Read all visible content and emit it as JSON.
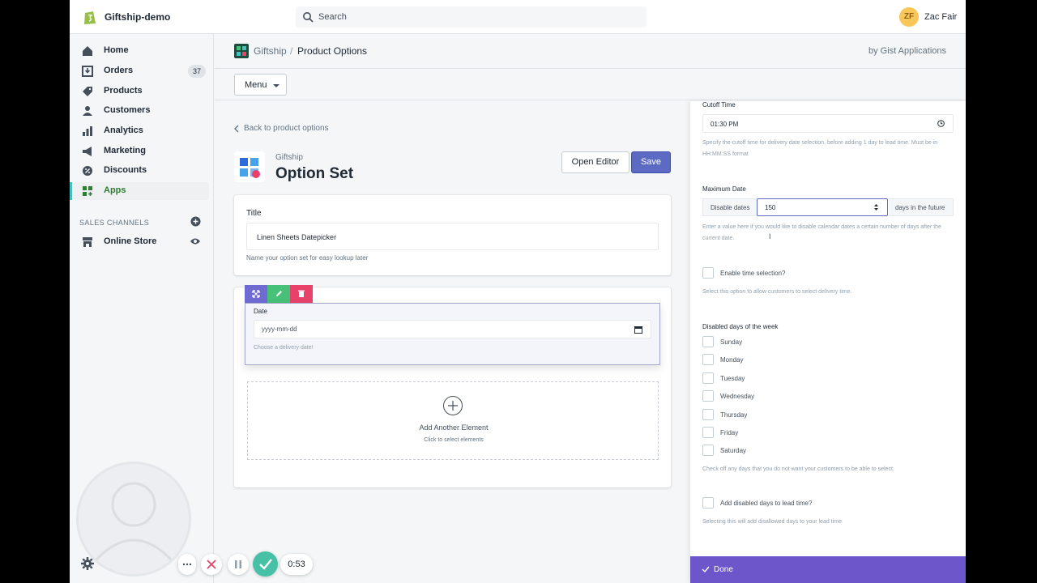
{
  "topbar": {
    "store_name": "Giftship-demo",
    "search_placeholder": "Search",
    "user_initials": "ZF",
    "user_name": "Zac Fair"
  },
  "sidebar": {
    "items": [
      {
        "label": "Home",
        "icon": "home-icon"
      },
      {
        "label": "Orders",
        "icon": "orders-icon",
        "badge": "37"
      },
      {
        "label": "Products",
        "icon": "tag-icon"
      },
      {
        "label": "Customers",
        "icon": "person-icon"
      },
      {
        "label": "Analytics",
        "icon": "bar-chart-icon"
      },
      {
        "label": "Marketing",
        "icon": "megaphone-icon"
      },
      {
        "label": "Discounts",
        "icon": "discount-icon"
      },
      {
        "label": "Apps",
        "icon": "apps-icon",
        "active": true
      }
    ],
    "sales_channels_title": "SALES CHANNELS",
    "online_store_label": "Online Store"
  },
  "app_header": {
    "app_name": "Giftship",
    "separator": "/",
    "page_name": "Product Options",
    "by_line": "by Gist Applications",
    "menu_label": "Menu"
  },
  "main": {
    "back_link": "Back to product options",
    "subtitle": "Giftship",
    "title": "Option Set",
    "open_editor_label": "Open Editor",
    "save_label": "Save",
    "title_card": {
      "label": "Title",
      "value": "Linen Sheets Datepicker",
      "help": "Name your option set for easy lookup later"
    },
    "date_element": {
      "label": "Date",
      "placeholder": "yyyy-mm-dd",
      "help": "Choose a delivery date!"
    },
    "add_element": {
      "title": "Add Another Element",
      "subtitle": "Click to select elements"
    }
  },
  "panel": {
    "cutoff_label": "Cutoff Time",
    "cutoff_value": "01:30 PM",
    "cutoff_help": "Specify the cutoff time for delivery date selection, before adding 1 day to lead time. Must be in HH:MM:SS format",
    "max_date_label": "Maximum Date",
    "disable_dates_prefix": "Disable dates",
    "max_date_value": "150",
    "days_suffix": "days in the future",
    "max_date_help": "Enter a value here if you would like to disable calendar dates a certain number of days after the current date.",
    "enable_time_label": "Enable time selection?",
    "enable_time_help": "Select this option to allow customers to select delivery time.",
    "disabled_days_title": "Disabled days of the week",
    "days": [
      "Sunday",
      "Monday",
      "Tuesday",
      "Wednesday",
      "Thursday",
      "Friday",
      "Saturday"
    ],
    "days_help": "Check off any days that you do not want your customers to be able to select.",
    "add_disabled_label": "Add disabled days to lead time?",
    "add_disabled_help": "Selecting this will add disallowed days to your lead time",
    "done_label": "Done"
  },
  "recorder": {
    "time": "0:53"
  },
  "colors": {
    "primary": "#5c6ac4",
    "done_bar": "#6c56c9",
    "active_nav": "#2e7d32"
  }
}
